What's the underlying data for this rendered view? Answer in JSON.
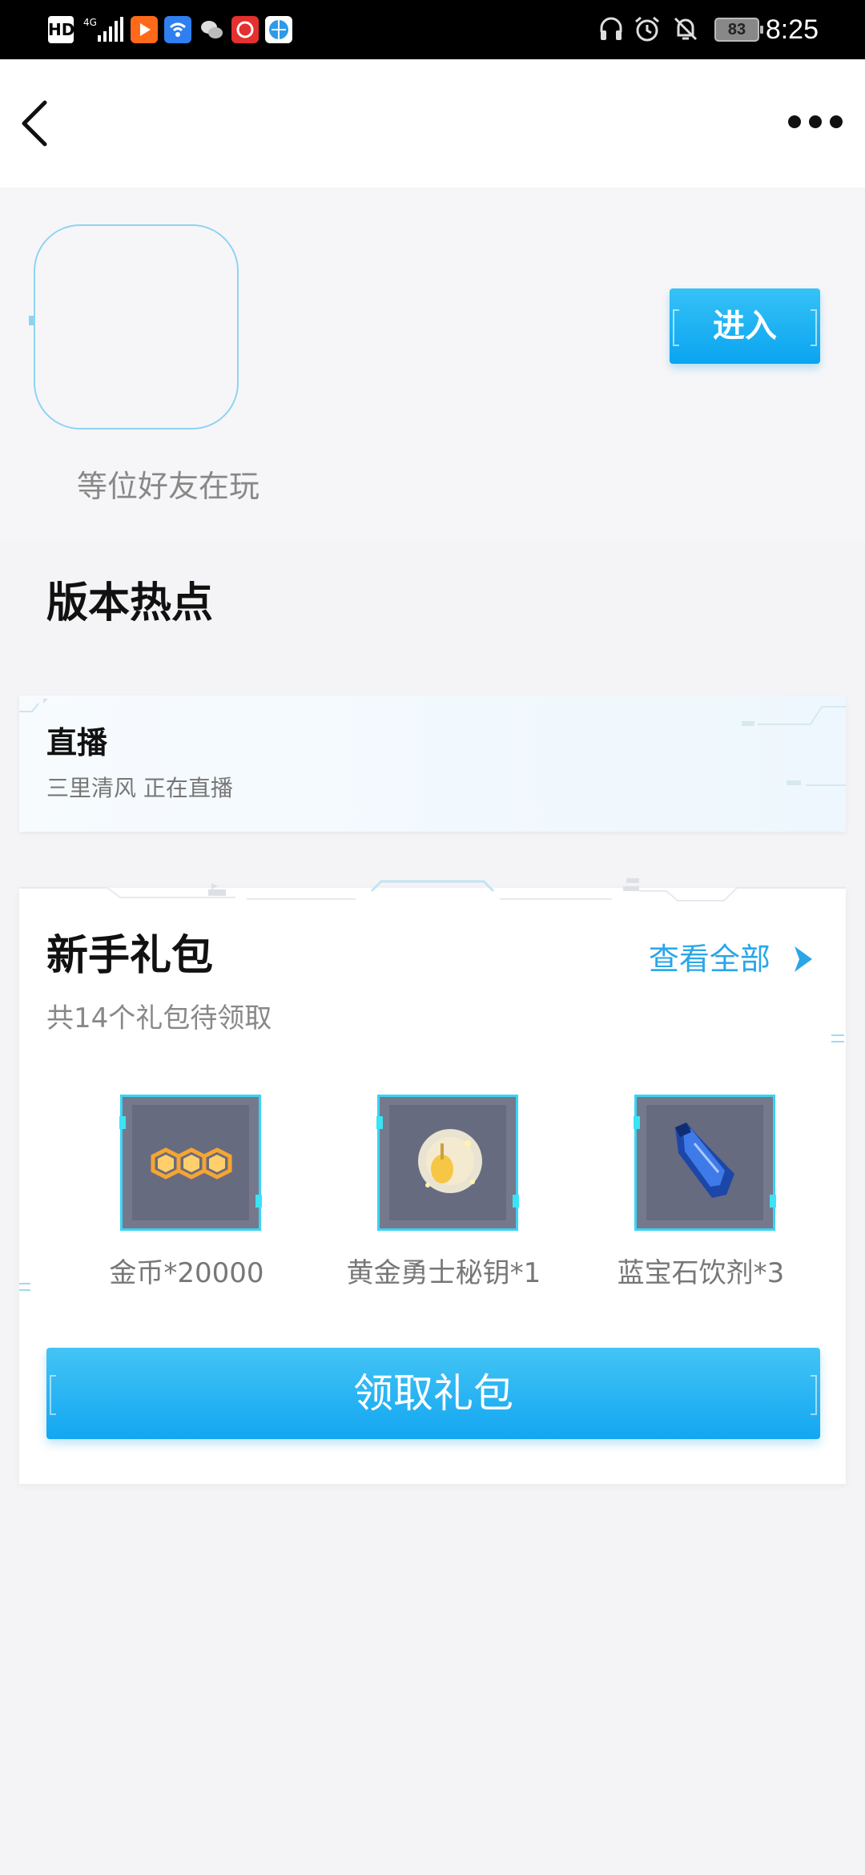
{
  "status_bar": {
    "hd_label": "HD",
    "network_label": "4G",
    "battery_level": "83",
    "time": "8:25",
    "icons": [
      "hd-icon",
      "signal-icon",
      "video-app-icon",
      "wifi-app-icon",
      "wechat-icon",
      "netease-music-icon",
      "browser-icon",
      "headphones-icon",
      "alarm-icon",
      "mute-icon",
      "battery-icon"
    ]
  },
  "nav": {
    "back_icon": "chevron-left-icon",
    "more_icon": "more-dots-icon"
  },
  "game": {
    "friends_text": "等位好友在玩",
    "enter_label": "进入"
  },
  "hot_section": {
    "title": "版本热点",
    "live": {
      "title": "直播",
      "subtitle": "三里清风 正在直播"
    }
  },
  "gift_section": {
    "title": "新手礼包",
    "view_all_label": "查看全部",
    "count_text": "共14个礼包待领取",
    "items": [
      {
        "label": "金币*20000",
        "icon": "gold-coins-icon"
      },
      {
        "label": "黄金勇士秘钥*1",
        "icon": "golden-key-icon"
      },
      {
        "label": "蓝宝石饮剂*3",
        "icon": "sapphire-potion-icon"
      }
    ],
    "claim_label": "领取礼包"
  },
  "colors": {
    "accent": "#14a6f2",
    "link": "#2aa6e8",
    "frame": "#3ad4f5"
  }
}
